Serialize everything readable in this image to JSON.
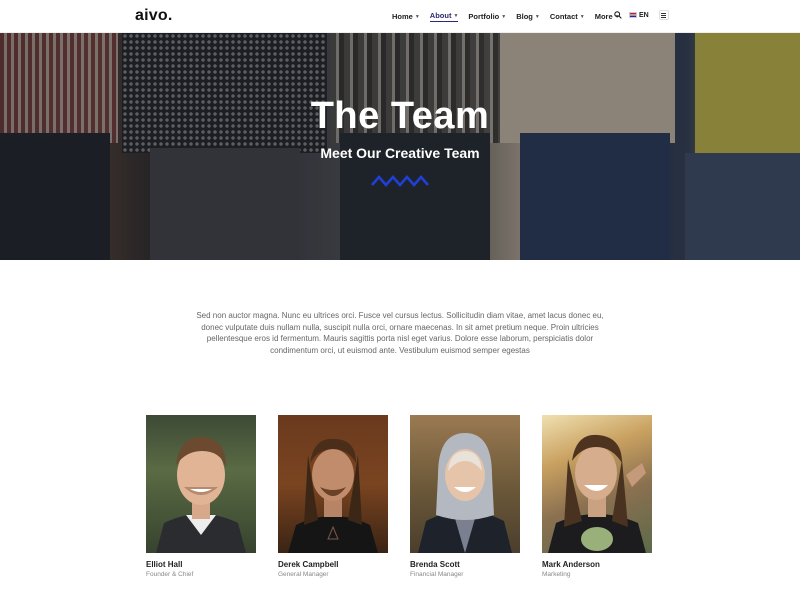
{
  "header": {
    "logo": "aivo.",
    "nav": [
      {
        "label": "Home",
        "active": false
      },
      {
        "label": "About",
        "active": true
      },
      {
        "label": "Portfolio",
        "active": false
      },
      {
        "label": "Blog",
        "active": false
      },
      {
        "label": "Contact",
        "active": false
      },
      {
        "label": "More",
        "active": false
      }
    ],
    "lang": "EN"
  },
  "hero": {
    "title": "The Team",
    "subtitle": "Meet Our Creative Team",
    "accent_color": "#1f3fd6"
  },
  "intro": {
    "text": "Sed non auctor magna. Nunc eu ultrices orci. Fusce vel cursus lectus. Sollicitudin diam vitae, amet lacus donec eu, donec vulputate duis nullam nulla, suscipit nulla orci, ornare maecenas. In sit amet pretium neque. Proin ultricies pellentesque eros id fermentum. Mauris sagittis porta nisl eget varius. Dolore esse laborum, perspiciatis dolor condimentum orci, ut euismod ante. Vestibulum euismod semper egestas"
  },
  "team": [
    {
      "name": "Elliot Hall",
      "role": "Founder & Chief"
    },
    {
      "name": "Derek Campbell",
      "role": "General Manager"
    },
    {
      "name": "Brenda Scott",
      "role": "Financial Manager"
    },
    {
      "name": "Mark Anderson",
      "role": "Marketing"
    }
  ]
}
